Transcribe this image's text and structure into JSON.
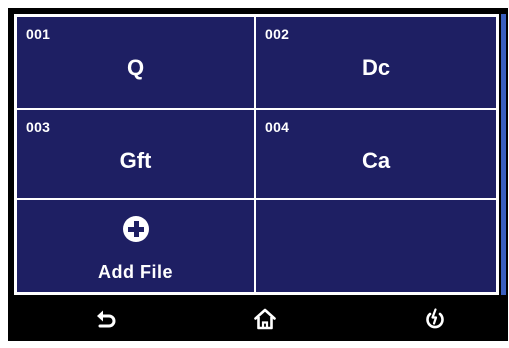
{
  "files": [
    {
      "number": "001",
      "name": "Q"
    },
    {
      "number": "002",
      "name": "Dc"
    },
    {
      "number": "003",
      "name": "Gft"
    },
    {
      "number": "004",
      "name": "Ca"
    }
  ],
  "add_file": {
    "label": "Add  File",
    "icon": "plus-circle-icon"
  },
  "bottom_bar": {
    "back_icon": "back-arrow-icon",
    "home_icon": "home-icon",
    "power_icon": "power-icon"
  },
  "colors": {
    "cell_background": "#1e1f63",
    "grid_lines": "#ffffff",
    "scroll_thumb": "#3a5fbf",
    "bar_background": "#000000"
  }
}
